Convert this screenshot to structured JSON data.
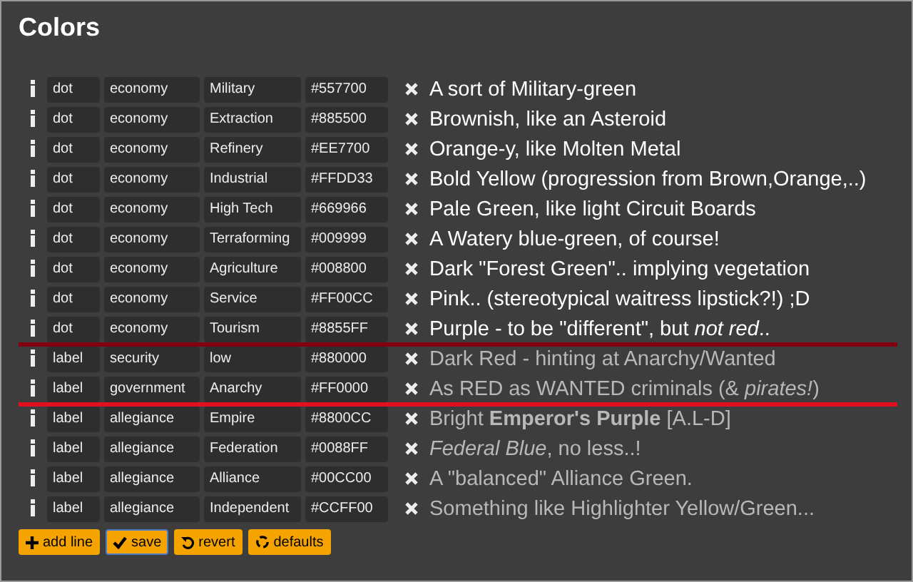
{
  "title": "Colors",
  "rows": [
    {
      "type": "dot",
      "category": "economy",
      "name": "Military",
      "hex": "#557700",
      "description": "A sort of Military-green",
      "dimmed": false
    },
    {
      "type": "dot",
      "category": "economy",
      "name": "Extraction",
      "hex": "#885500",
      "description": "Brownish, like an Asteroid",
      "dimmed": false
    },
    {
      "type": "dot",
      "category": "economy",
      "name": "Refinery",
      "hex": "#EE7700",
      "description": "Orange-y, like Molten Metal",
      "dimmed": false
    },
    {
      "type": "dot",
      "category": "economy",
      "name": "Industrial",
      "hex": "#FFDD33",
      "description": "Bold Yellow (progression from Brown,Orange,..)",
      "dimmed": false
    },
    {
      "type": "dot",
      "category": "economy",
      "name": "High Tech",
      "hex": "#669966",
      "description": "Pale Green, like light Circuit Boards",
      "dimmed": false
    },
    {
      "type": "dot",
      "category": "economy",
      "name": "Terraforming",
      "hex": "#009999",
      "description": "A Watery blue-green, of course!",
      "dimmed": false
    },
    {
      "type": "dot",
      "category": "economy",
      "name": "Agriculture",
      "hex": "#008800",
      "description": "Dark \"Forest Green\".. implying vegetation",
      "dimmed": false
    },
    {
      "type": "dot",
      "category": "economy",
      "name": "Service",
      "hex": "#FF00CC",
      "description": "Pink.. (stereotypical waitress lipstick?!)  ;D",
      "dimmed": false
    },
    {
      "type": "dot",
      "category": "economy",
      "name": "Tourism",
      "hex": "#8855FF",
      "description": "Purple - to be \"different\", but *not red*..",
      "dimmed": false
    },
    {
      "kind": "divider",
      "color": "#800010"
    },
    {
      "type": "label",
      "category": "security",
      "name": "low",
      "hex": "#880000",
      "description": "Dark Red - hinting at Anarchy/Wanted",
      "dimmed": true
    },
    {
      "type": "label",
      "category": "government",
      "name": "Anarchy",
      "hex": "#FF0000",
      "description": "As RED as WANTED criminals (& *pirates!*)",
      "dimmed": true
    },
    {
      "kind": "divider",
      "color": "#e01020"
    },
    {
      "type": "label",
      "category": "allegiance",
      "name": "Empire",
      "hex": "#8800CC",
      "description": "Bright **Emperor's Purple** [A.L-D]",
      "dimmed": true
    },
    {
      "type": "label",
      "category": "allegiance",
      "name": "Federation",
      "hex": "#0088FF",
      "description": "*Federal Blue*, no less..!",
      "dimmed": true
    },
    {
      "type": "label",
      "category": "allegiance",
      "name": "Alliance",
      "hex": "#00CC00",
      "description": "A \"balanced\" Alliance Green.",
      "dimmed": true
    },
    {
      "type": "label",
      "category": "allegiance",
      "name": "Independent",
      "hex": "#CCFF00",
      "description": "Something like Highlighter Yellow/Green...",
      "dimmed": true
    }
  ],
  "buttons": [
    {
      "label": "add line",
      "kind": "add",
      "focused": false
    },
    {
      "label": "save",
      "kind": "save",
      "focused": true
    },
    {
      "label": "revert",
      "kind": "revert",
      "focused": false
    },
    {
      "label": "defaults",
      "kind": "reset",
      "focused": false
    }
  ]
}
